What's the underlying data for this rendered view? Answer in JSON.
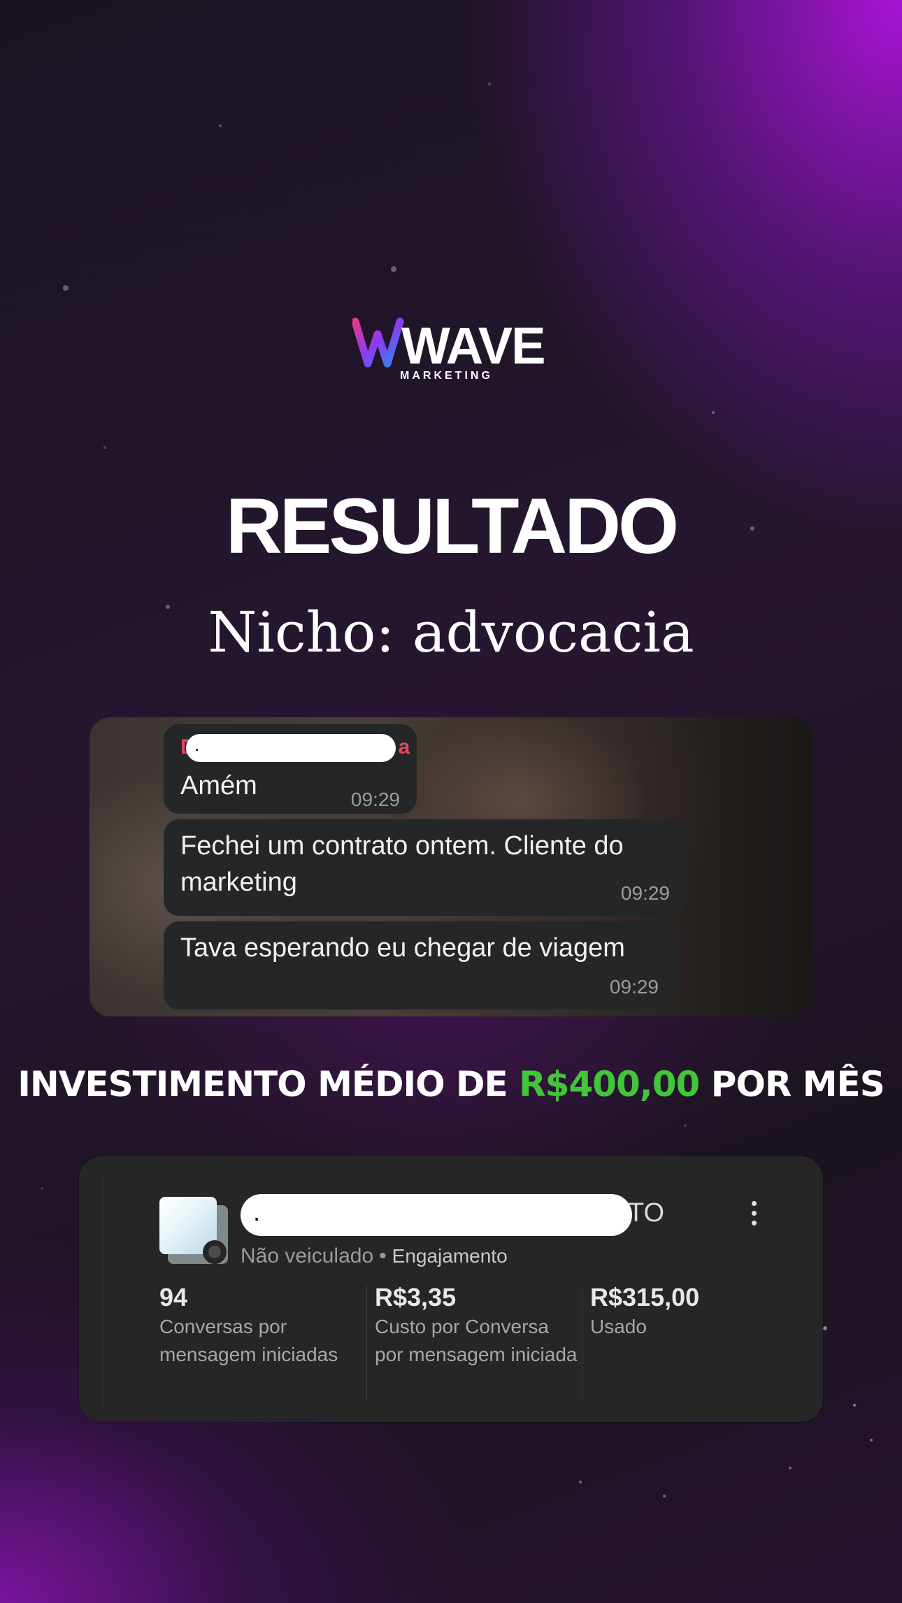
{
  "brand": {
    "logo_text": "WAVE",
    "logo_subtext": "MARKETING"
  },
  "hero": {
    "title": "RESULTADO",
    "subtitle": "Nicho: advocacia"
  },
  "chat": {
    "messages": [
      {
        "sender": "D",
        "sender_end": "a",
        "redacted_placeholder": ".",
        "text": "Amém",
        "time": "09:29"
      },
      {
        "text": "Fechei um contrato ontem. Cliente do marketing",
        "time": "09:29"
      },
      {
        "text": "Tava esperando eu chegar de viagem",
        "time": "09:29"
      }
    ]
  },
  "investment": {
    "prefix": "INVESTIMENTO MÉDIO DE ",
    "amount": "R$400,00",
    "suffix": " POR MÊS",
    "amount_color": "#41c63a"
  },
  "ad": {
    "name_redacted_placeholder": ".",
    "name_tail": "TO",
    "status": "Não veiculado",
    "separator": "•",
    "objective": "Engajamento",
    "metrics": [
      {
        "value": "94",
        "label": "Conversas por mensagem iniciadas"
      },
      {
        "value": "R$3,35",
        "label": "Custo por Conversa por mensagem iniciada"
      },
      {
        "value": "R$315,00",
        "label": "Usado"
      }
    ],
    "menu_icon": "more-vertical-icon"
  }
}
